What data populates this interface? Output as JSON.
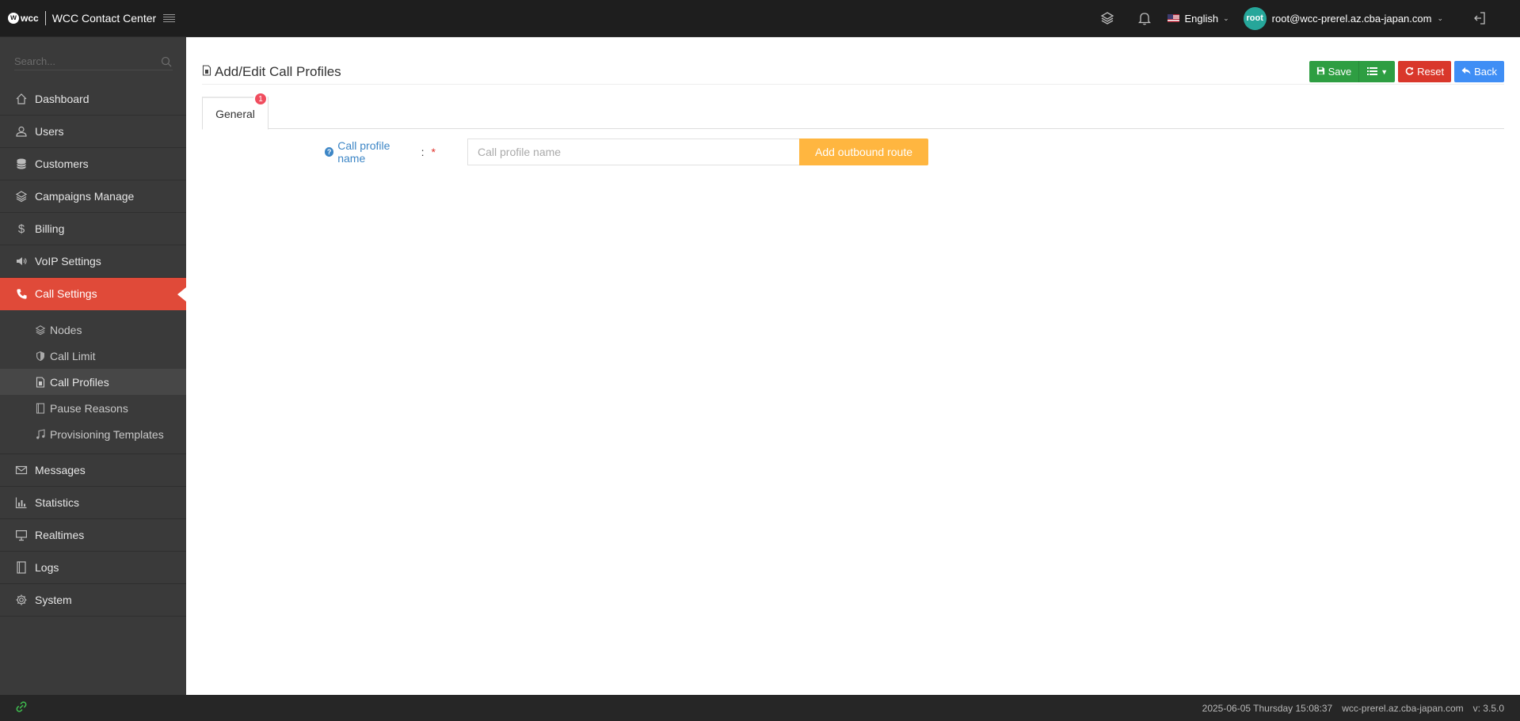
{
  "topbar": {
    "logo_text": "wcc",
    "app_title": "WCC Contact Center",
    "language": "English",
    "avatar_text": "root",
    "user_email": "root@wcc-prerel.az.cba-japan.com"
  },
  "sidebar": {
    "search_placeholder": "Search...",
    "items": [
      {
        "label": "Dashboard",
        "icon": "home-icon"
      },
      {
        "label": "Users",
        "icon": "user-icon"
      },
      {
        "label": "Customers",
        "icon": "database-icon"
      },
      {
        "label": "Campaigns Manage",
        "icon": "layers-icon"
      },
      {
        "label": "Billing",
        "icon": "dollar-icon"
      },
      {
        "label": "VoIP Settings",
        "icon": "volume-icon"
      },
      {
        "label": "Call Settings",
        "icon": "phone-icon"
      }
    ],
    "sub_items": [
      {
        "label": "Nodes",
        "icon": "layers-icon"
      },
      {
        "label": "Call Limit",
        "icon": "shield-icon"
      },
      {
        "label": "Call Profiles",
        "icon": "file-icon"
      },
      {
        "label": "Pause Reasons",
        "icon": "book-icon"
      },
      {
        "label": "Provisioning Templates",
        "icon": "music-icon"
      }
    ],
    "items_after": [
      {
        "label": "Messages",
        "icon": "envelope-icon"
      },
      {
        "label": "Statistics",
        "icon": "bar-chart-icon"
      },
      {
        "label": "Realtimes",
        "icon": "monitor-icon"
      },
      {
        "label": "Logs",
        "icon": "book-icon"
      },
      {
        "label": "System",
        "icon": "gear-icon"
      }
    ]
  },
  "page": {
    "title": "Add/Edit Call Profiles",
    "actions": {
      "save": "Save",
      "reset": "Reset",
      "back": "Back"
    },
    "tabs": [
      {
        "label": "General",
        "badge": "1"
      }
    ],
    "form": {
      "call_profile_name_label": "Call profile name",
      "colon": ":",
      "required_mark": "*",
      "call_profile_name_placeholder": "Call profile name",
      "call_profile_name_value": "",
      "add_route_button": "Add outbound route"
    }
  },
  "footer": {
    "datetime": "2025-06-05 Thursday 15:08:37",
    "host": "wcc-prerel.az.cba-japan.com",
    "version": "v: 3.5.0"
  },
  "colors": {
    "active_nav": "#e04a39",
    "save_button": "#2e9e42",
    "reset_button": "#d9372b",
    "back_button": "#3f8ef5",
    "add_route_button": "#ffb640",
    "label_blue": "#3d86c6"
  }
}
